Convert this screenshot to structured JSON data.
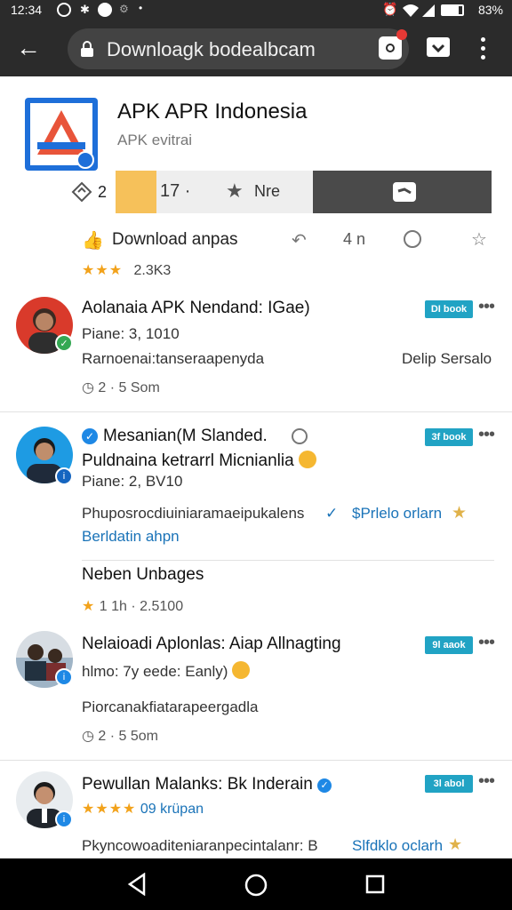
{
  "status_bar": {
    "time": "12:34",
    "battery": "83%"
  },
  "browser": {
    "url": "Downloagk bodealbcam"
  },
  "app": {
    "title": "APK APR Indonesia",
    "subtitle": "APK evitrai",
    "stat_count": "2",
    "button_light_text": "17 ·",
    "button_light_label": "Nre",
    "download_label": "Download anpas",
    "count_text": "4 n",
    "rating_stars": "★★★",
    "rating_count": "2.3K3"
  },
  "items": [
    {
      "title": "Aolanaia APK Nendand: IGae)",
      "line1": "Piane: 3, 1010",
      "line2": "Rarnoenai:tanseraapenyda",
      "line2_right": "Delip Sersalo",
      "meta": "2 · 5 Som",
      "chip": "DI book",
      "avatar_bg": "#d93a2b"
    },
    {
      "title": "Mesanian(M Slanded.",
      "line1": "Puldnaina ketrarrl Micnianlia",
      "line2": "Piane: 2, BV10",
      "line3": "Phuposrocdiuiniaramaeipukalens",
      "line3_link": "$Prlelo orlarn",
      "line4": "Berldatin ahpn",
      "section_title": "Neben Unbages",
      "section_rating": "1 1h · 2.5100",
      "chip": "3f book",
      "avatar_bg": "#1e9be3"
    },
    {
      "title": "Nelaioadi Aplonlas: Aiap Allnagting",
      "line1": "hlmo: 7y eede: Eanly)",
      "line2": "Piorcanakfiatarapeergadla",
      "meta": "2 · 5 5om",
      "chip": "9l aaok",
      "avatar_bg": "#d7dde3"
    },
    {
      "title": "Pewullan Malanks: Bk Inderain",
      "rating_text": "09 krüpan",
      "line2": "Pkyncowoaditeniaranpecintalanr: B",
      "line2_link": "Slfdklo oclarh",
      "chip": "3l abol",
      "avatar_bg": "#e8ecef"
    }
  ],
  "colors": {
    "chip": "#21a3c4",
    "star": "#f2a21b",
    "link": "#1a73b8",
    "yellow_button": "#f6c15a",
    "dark_button": "#4a4a4a"
  }
}
